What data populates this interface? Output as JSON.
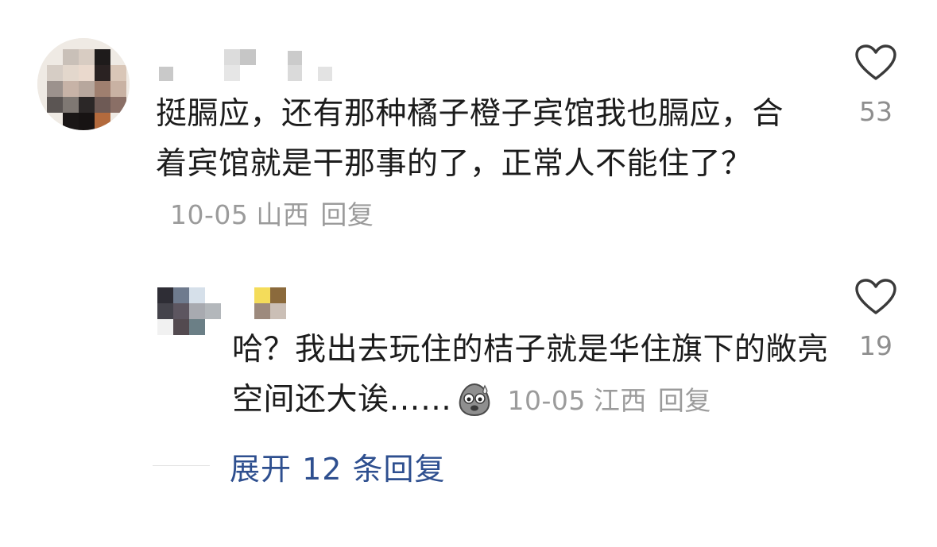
{
  "comments": [
    {
      "text": "挺膈应，还有那种橘子橙子宾馆我也膈应，合着宾馆就是干那事的了，正常人不能住了？",
      "date": "10-05",
      "location": "山西",
      "reply_label": "回复",
      "likes": "53"
    },
    {
      "text": "哈？我出去玩住的桔子就是华住旗下的敞亮空间还大诶……",
      "date": "10-05",
      "location": "江西",
      "reply_label": "回复",
      "likes": "19"
    }
  ],
  "expand_replies": "展开 12 条回复",
  "icons": {
    "like": "heart-outline-icon",
    "emoji": "sweating-face-emoji-icon"
  },
  "colors": {
    "text": "#1c1c1c",
    "meta": "#9b9b9b",
    "link": "#2e4f8f"
  }
}
